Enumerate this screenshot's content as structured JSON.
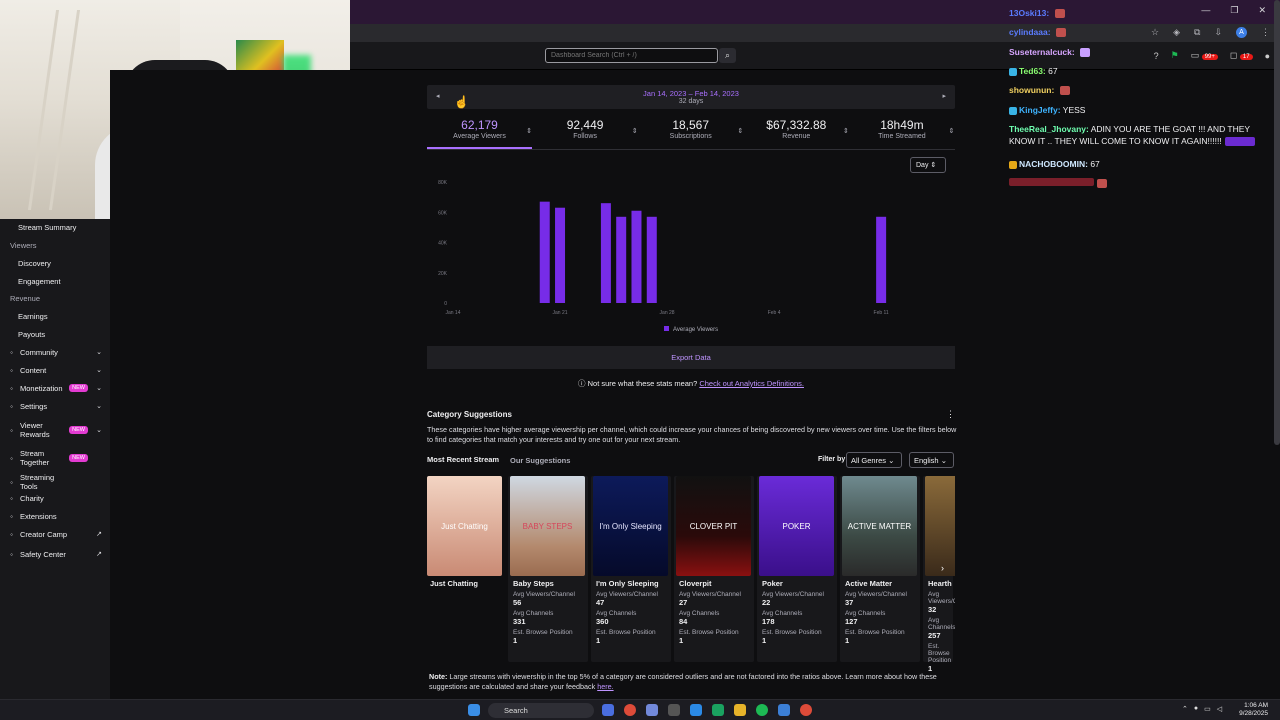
{
  "browser": {
    "window_controls": [
      "—",
      "❐",
      "✕"
    ],
    "profile_letter": "A"
  },
  "topnav": {
    "search_placeholder": "Dashboard Search (Ctrl + /)",
    "notif_count": "99+",
    "whisper_count": "17"
  },
  "sidebar": {
    "items": [
      {
        "label": "Stream Summary",
        "kind": "sub"
      },
      {
        "label": "Viewers",
        "kind": "section"
      },
      {
        "label": "Discovery",
        "kind": "sub"
      },
      {
        "label": "Engagement",
        "kind": "sub"
      },
      {
        "label": "Revenue",
        "kind": "section"
      },
      {
        "label": "Earnings",
        "kind": "sub"
      },
      {
        "label": "Payouts",
        "kind": "sub"
      },
      {
        "label": "Community",
        "kind": "top",
        "icon": "people-icon",
        "chev": true
      },
      {
        "label": "Content",
        "kind": "top",
        "icon": "content-icon",
        "chev": true
      },
      {
        "label": "Monetization",
        "kind": "top",
        "icon": "money-icon",
        "chev": true,
        "badge": "NEW"
      },
      {
        "label": "Settings",
        "kind": "top",
        "icon": "gear-icon",
        "chev": true
      },
      {
        "label": "Viewer Rewards",
        "kind": "top",
        "icon": "gift-icon",
        "chev": true,
        "badge": "NEW"
      },
      {
        "label": "Stream Together",
        "kind": "top",
        "icon": "stream-together-icon",
        "badge": "NEW"
      },
      {
        "label": "Streaming Tools",
        "kind": "top",
        "icon": "tools-icon"
      },
      {
        "label": "Charity",
        "kind": "top",
        "icon": "heart-icon"
      },
      {
        "label": "Extensions",
        "kind": "top",
        "icon": "extension-icon"
      },
      {
        "label": "Creator Camp",
        "kind": "top",
        "icon": "camp-icon",
        "ext": true
      },
      {
        "label": "Safety Center",
        "kind": "top",
        "icon": "shield-icon",
        "ext": true
      }
    ]
  },
  "date_range": {
    "label": "Jan 14, 2023 – Feb 14, 2023",
    "days": "32 days"
  },
  "stats": [
    {
      "value": "62,179",
      "label": "Average Viewers",
      "active": true
    },
    {
      "value": "92,449",
      "label": "Follows",
      "active": false
    },
    {
      "value": "18,567",
      "label": "Subscriptions",
      "active": false
    },
    {
      "value": "$67,332.88",
      "label": "Revenue",
      "active": false
    },
    {
      "value": "18h49m",
      "label": "Time Streamed",
      "active": false
    }
  ],
  "granularity": "Day",
  "chart_data": {
    "type": "bar",
    "title": "",
    "xlabel": "",
    "ylabel": "",
    "ylim": [
      0,
      80000
    ],
    "y_ticks": [
      "0",
      "20K",
      "40K",
      "60K",
      "80K"
    ],
    "x_ticks": [
      "Jan 14",
      "Jan 21",
      "Jan 28",
      "Feb 4",
      "Feb 11"
    ],
    "categories": [
      "Jan 14",
      "Jan 15",
      "Jan 16",
      "Jan 17",
      "Jan 18",
      "Jan 19",
      "Jan 20",
      "Jan 21",
      "Jan 22",
      "Jan 23",
      "Jan 24",
      "Jan 25",
      "Jan 26",
      "Jan 27",
      "Jan 28",
      "Jan 29",
      "Jan 30",
      "Jan 31",
      "Feb 1",
      "Feb 2",
      "Feb 3",
      "Feb 4",
      "Feb 5",
      "Feb 6",
      "Feb 7",
      "Feb 8",
      "Feb 9",
      "Feb 10",
      "Feb 11",
      "Feb 12",
      "Feb 13",
      "Feb 14"
    ],
    "series": [
      {
        "name": "Average Viewers",
        "color": "#772ce8",
        "values": [
          0,
          0,
          0,
          0,
          0,
          0,
          67000,
          63000,
          0,
          0,
          66000,
          57000,
          61000,
          57000,
          0,
          0,
          0,
          0,
          0,
          0,
          0,
          0,
          0,
          0,
          0,
          0,
          0,
          0,
          57000,
          0,
          0,
          0
        ]
      }
    ],
    "legend": "bottom",
    "grid": false
  },
  "export_label": "Export Data",
  "help": {
    "question": "Not sure what these stats mean?",
    "link": "Check out Analytics Definitions."
  },
  "categories_section": {
    "title": "Category Suggestions",
    "description": "These categories have higher average viewership per channel, which could increase your chances of being discovered by new viewers over time. Use the filters below to find categories that match your interests and try one out for your next stream.",
    "tab_recent": "Most Recent Stream",
    "tab_ours": "Our Suggestions",
    "filter_label": "Filter by",
    "genre_select": "All Genres",
    "language_select": "English",
    "k_avg_viewers": "Avg Viewers/Channel",
    "k_avg_channels": "Avg Channels",
    "k_browse": "Est. Browse Position",
    "recent": {
      "name": "Just Chatting",
      "cover_text": "Just Chatting"
    },
    "cards": [
      {
        "name": "Baby Steps",
        "cover_text": "BABY STEPS",
        "avg_viewers": "56",
        "avg_channels": "331",
        "browse": "1"
      },
      {
        "name": "I'm Only Sleeping",
        "cover_text": "I'm Only Sleeping",
        "avg_viewers": "47",
        "avg_channels": "360",
        "browse": "1"
      },
      {
        "name": "Cloverpit",
        "cover_text": "CLOVER PIT",
        "avg_viewers": "27",
        "avg_channels": "84",
        "browse": "1"
      },
      {
        "name": "Poker",
        "cover_text": "POKER",
        "avg_viewers": "22",
        "avg_channels": "178",
        "browse": "1"
      },
      {
        "name": "Active Matter",
        "cover_text": "ACTIVE MATTER",
        "avg_viewers": "37",
        "avg_channels": "127",
        "browse": "1"
      },
      {
        "name": "Hearth",
        "cover_text": "",
        "avg_viewers": "32",
        "avg_channels": "257",
        "browse": "1"
      }
    ]
  },
  "note": {
    "label": "Note:",
    "text": "Large streams with viewership in the top 5% of a category are considered outliers and are not factored into the ratios above. Learn more about how these suggestions are calculated and share your feedback",
    "link": "here."
  },
  "chat": [
    {
      "user": "13Oski13:",
      "color": "#5b7cff",
      "msg": ""
    },
    {
      "user": "cylindaaa:",
      "color": "#5b7cff",
      "msg": ""
    },
    {
      "user": "Suseternalcuck:",
      "color": "#d7a6ff",
      "msg": ""
    },
    {
      "user": "Ted63:",
      "color": "#8bff72",
      "msg": "67"
    },
    {
      "user": "showunun:",
      "color": "#f0d060",
      "msg": ""
    },
    {
      "user": "KingJeffy:",
      "color": "#3fb4ff",
      "msg": "YESS"
    },
    {
      "user": "TheeReal_Jhovany:",
      "color": "#6fffb0",
      "msg": "ADIN YOU ARE THE GOAT !!! AND THEY KNOW IT .. THEY WILL COME TO KNOW IT AGAIN!!!!!!"
    },
    {
      "user": "NACHOBOOMIN:",
      "color": "#cfe8ff",
      "msg": "67"
    }
  ],
  "taskbar": {
    "search": "Search",
    "time": "1:06 AM",
    "date": "9/28/2025"
  }
}
